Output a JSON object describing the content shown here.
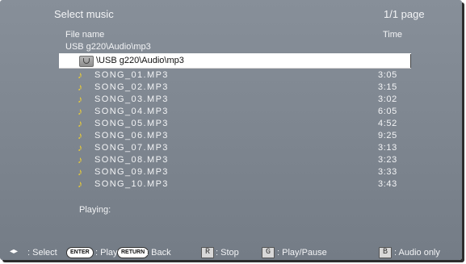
{
  "header": {
    "title": "Select music",
    "page_indicator": "1/1 page"
  },
  "columns": {
    "file": "File name",
    "time": "Time"
  },
  "current_path": "USB g220\\Audio\\mp3",
  "selected_row": {
    "label": "\\USB g220\\Audio\\mp3",
    "icon": "folder-up-icon"
  },
  "songs": [
    {
      "name": "SONG_01.MP3",
      "time": "3:05"
    },
    {
      "name": "SONG_02.MP3",
      "time": "3:15"
    },
    {
      "name": "SONG_03.MP3",
      "time": "3:02"
    },
    {
      "name": "SONG_04.MP3",
      "time": "6:05"
    },
    {
      "name": "SONG_05.MP3",
      "time": "4:52"
    },
    {
      "name": "SONG_06.MP3",
      "time": "9:25"
    },
    {
      "name": "SONG_07.MP3",
      "time": "3:13"
    },
    {
      "name": "SONG_08.MP3",
      "time": "3:23"
    },
    {
      "name": "SONG_09.MP3",
      "time": "3:33"
    },
    {
      "name": "SONG_10.MP3",
      "time": "3:43"
    }
  ],
  "playing_label": "Playing:",
  "footer": {
    "select": ": Select",
    "enter_key": "ENTER",
    "play": ": Play",
    "return_key": "RETURN",
    "back": ": Back",
    "r_key": "R",
    "stop": ": Stop",
    "g_key": "G",
    "play_pause": ": Play/Pause",
    "b_key": "B",
    "audio_only": ": Audio only"
  },
  "colors": {
    "background": "#7f8791",
    "note": "#f1d130",
    "selection": "#ffffff"
  }
}
